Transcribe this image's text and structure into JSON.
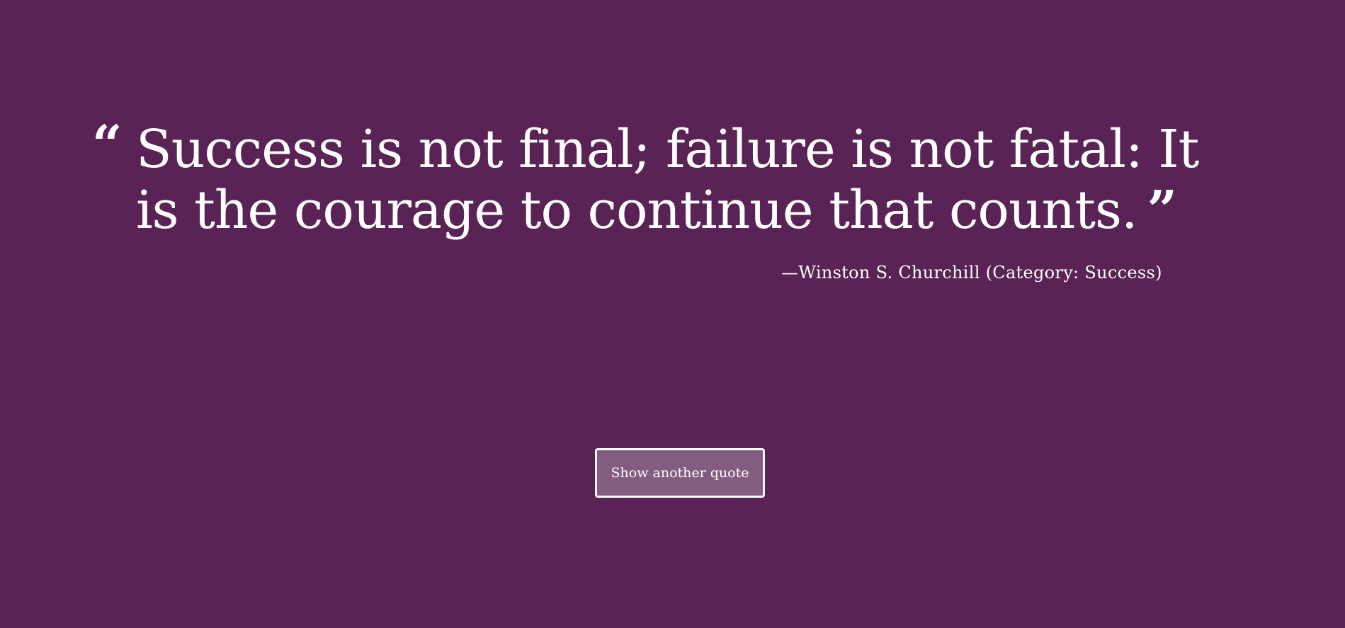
{
  "colors": {
    "background": "#5a2355",
    "text": "#ffffff",
    "button_fill": "#835c82",
    "button_border": "#ffffff"
  },
  "quote": {
    "open_mark": "“",
    "text": "Success is not final; failure is not fatal: It is the courage to continue that counts.",
    "close_mark": "”",
    "attribution": "—Winston S. Churchill (Category: Success)"
  },
  "actions": {
    "next_label": "Show another quote"
  }
}
